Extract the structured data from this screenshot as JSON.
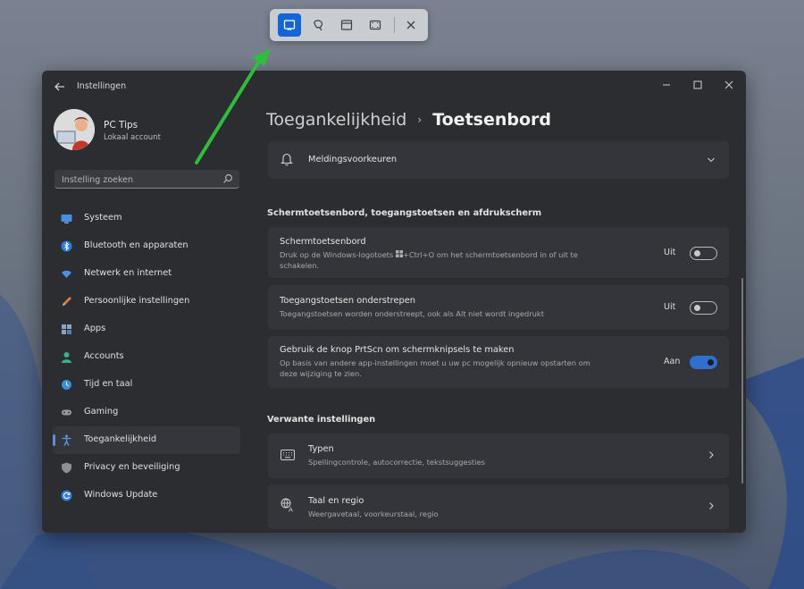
{
  "window": {
    "title": "Instellingen"
  },
  "profile": {
    "name": "PC Tips",
    "account_type": "Lokaal account"
  },
  "search": {
    "placeholder": "Instelling zoeken"
  },
  "sidebar": {
    "items": [
      {
        "label": "Systeem",
        "icon": "monitor-icon"
      },
      {
        "label": "Bluetooth en apparaten",
        "icon": "bluetooth-icon"
      },
      {
        "label": "Netwerk en internet",
        "icon": "wifi-icon"
      },
      {
        "label": "Persoonlijke instellingen",
        "icon": "pencil-icon"
      },
      {
        "label": "Apps",
        "icon": "apps-icon"
      },
      {
        "label": "Accounts",
        "icon": "person-icon"
      },
      {
        "label": "Tijd en taal",
        "icon": "globe-clock-icon"
      },
      {
        "label": "Gaming",
        "icon": "gamepad-icon"
      },
      {
        "label": "Toegankelijkheid",
        "icon": "accessibility-icon",
        "active": true
      },
      {
        "label": "Privacy en beveiliging",
        "icon": "shield-icon"
      },
      {
        "label": "Windows Update",
        "icon": "update-icon"
      }
    ]
  },
  "breadcrumb": {
    "parent": "Toegankelijkheid",
    "separator": "›",
    "current": "Toetsenbord"
  },
  "notifications_card": {
    "label": "Meldingsvoorkeuren"
  },
  "section1": {
    "heading": "Schermtoetsenbord, toegangstoetsen en afdrukscherm",
    "items": [
      {
        "title": "Schermtoetsenbord",
        "desc_part1": "Druk op de Windows-logotoets",
        "desc_part2": "+Ctrl+O om het schermtoetsenbord in of uit te schakelen.",
        "state": "Uit",
        "on": false
      },
      {
        "title": "Toegangstoetsen onderstrepen",
        "desc": "Toegangstoetsen worden onderstreept, ook als Alt niet wordt ingedrukt",
        "state": "Uit",
        "on": false
      },
      {
        "title": "Gebruik de knop PrtScn om schermknipsels te maken",
        "desc": "Op basis van andere app-instellingen moet u uw pc mogelijk opnieuw opstarten om deze wijziging te zien.",
        "state": "Aan",
        "on": true
      }
    ]
  },
  "section2": {
    "heading": "Verwante instellingen",
    "items": [
      {
        "title": "Typen",
        "desc": "Spellingcontrole, autocorrectie, tekstsuggesties",
        "icon": "keyboard-icon"
      },
      {
        "title": "Taal en regio",
        "desc": "Weergavetaal, voorkeurstaal, regio",
        "icon": "language-icon"
      }
    ]
  },
  "colors": {
    "accent": "#1565d8",
    "toggle_on": "#2f6fd2",
    "arrow": "#2ebd3c"
  }
}
